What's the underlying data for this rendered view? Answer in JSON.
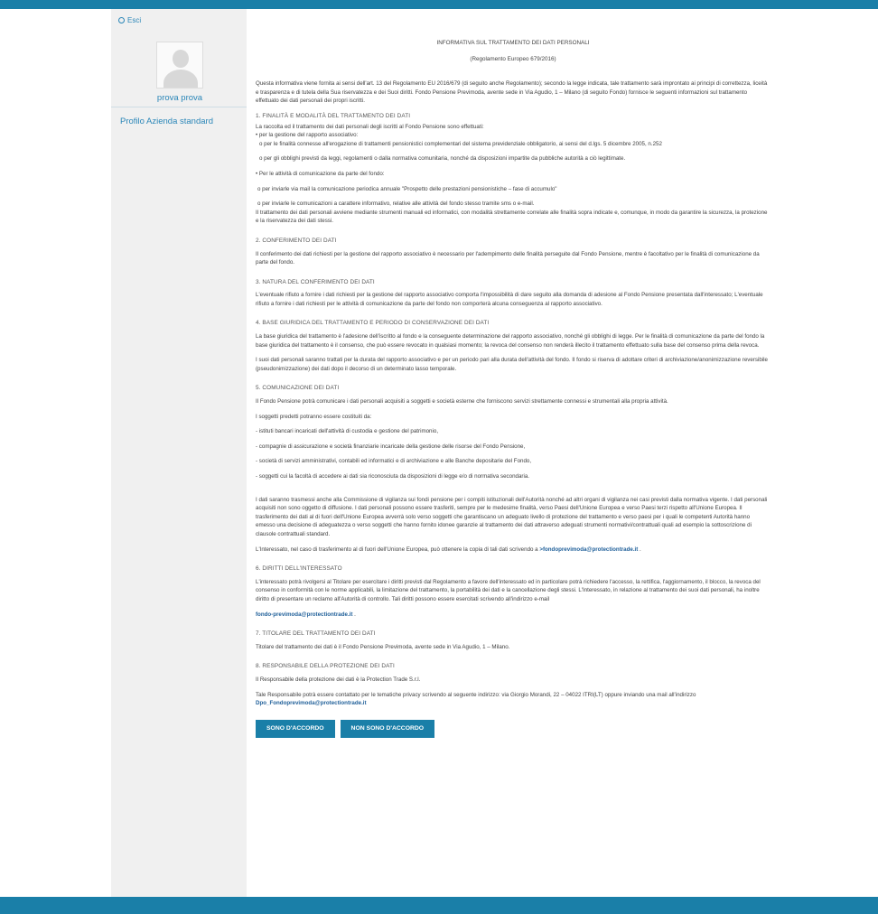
{
  "sidebar": {
    "logout_label": "Esci",
    "user_name": "prova prova",
    "profile_link": "Profilo Azienda standard"
  },
  "document": {
    "title": "INFORMATIVA SUL TRATTAMENTO DEI DATI PERSONALI",
    "subtitle": "(Regolamento Europeo 679/2016)",
    "intro": "Questa informativa viene fornita ai sensi dell'art. 13 del Regolamento EU 2016/679 (di seguito anche Regolamento); secondo la legge indicata, tale trattamento sarà improntato ai principi di correttezza, liceità e trasparenza e di tutela della Sua riservatezza e dei Suoi diritti. Fondo Pensione Previmoda, avente sede in Via Agudio, 1 – Milano (di seguito Fondo) fornisce le seguenti informazioni sul trattamento effettuato dei dati personali dei propri iscritti.",
    "s1": {
      "title": "1. FINALITÀ E MODALITÀ DEL TRATTAMENTO DEI DATI",
      "l1": "La raccolta ed il trattamento dei dati personali degli iscritti al Fondo Pensione sono effettuati:",
      "l2": "• per la gestione del rapporto associativo:",
      "l3": "o per le finalità connesse all'erogazione di trattamenti pensionistici complementari del sistema previdenziale obbligatorio, ai sensi del d.lgs. 5 dicembre 2005, n.252",
      "l4": "o per gli obblighi previsti da leggi, regolamenti o dalla normativa comunitaria, nonché da disposizioni impartite da pubbliche autorità a ciò legittimate.",
      "l5": "• Per le attività di comunicazione da parte del fondo:",
      "l6": "o per inviarle via mail la comunicazione periodica annuale \"Prospetto delle prestazioni pensionistiche – fase di accumulo\"",
      "l7": "o per inviarle le comunicazioni a carattere informativo, relative alle attività del fondo stesso tramite sms o e-mail.",
      "l8": "Il trattamento dei dati personali avviene mediante strumenti manuali ed informatici, con modalità strettamente correlate alle finalità sopra indicate e, comunque, in modo da garantire la sicurezza, la protezione e la riservatezza dei dati stessi."
    },
    "s2": {
      "title": "2. CONFERIMENTO DEI DATI",
      "text": "Il conferimento dei dati richiesti per la gestione del rapporto associativo è necessario per l'adempimento delle finalità perseguite dal Fondo Pensione, mentre è facoltativo per le finalità di comunicazione da parte del fondo."
    },
    "s3": {
      "title": "3. NATURA DEL CONFERIMENTO DEI DATI",
      "text": "L'eventuale rifiuto a fornire i dati richiesti per la gestione del rapporto associativo comporta l'impossibilità di dare seguito alla domanda di adesione al Fondo Pensione presentata dall'interessato; L'eventuale rifiuto a fornire i dati richiesti per le attività di comunicazione da parte del fondo non comporterà alcuna conseguenza al rapporto associativo."
    },
    "s4": {
      "title": "4. BASE GIURIDICA DEL TRATTAMENTO E PERIODO DI CONSERVAZIONE DEI DATI",
      "p1": "La base giuridica del trattamento è l'adesione dell'iscritto al fondo e la conseguente determinazione del rapporto associativo, nonché gli obblighi di legge. Per le finalità di comunicazione da parte del fondo la base giuridica del trattamento è il consenso, che può essere revocato in qualsiasi momento; la revoca del consenso non renderà illecito il trattamento effettuato sulla base del consenso prima della revoca.",
      "p2": "I suoi dati personali saranno trattati per la durata del rapporto associativo e per un periodo pari alla durata dell'attività del fondo. Il fondo si riserva di adottare criteri di archiviazione/anonimizzazione reversibile (pseudonimizzazione) dei dati dopo il decorso di un determinato lasso temporale."
    },
    "s5": {
      "title": "5. COMUNICAZIONE DEI DATI",
      "p1": "Il Fondo Pensione potrà comunicare i dati personali acquisiti a soggetti e società esterne che forniscono servizi strettamente connessi e strumentali alla propria attività.",
      "p2": "I soggetti predetti potranno essere costituiti da:",
      "b1": "- istituti bancari incaricati dell'attività di custodia e gestione del patrimonio,",
      "b2": "- compagnie di assicurazione e società finanziarie incaricate della gestione delle risorse del Fondo Pensione,",
      "b3": "- società di servizi amministrativi, contabili ed informatici e di archiviazione e alle Banche depositarie del Fondo,",
      "b4": "- soggetti cui la facoltà di accedere ai dati sia riconosciuta da disposizioni di legge e/o di normativa secondaria.",
      "p3": "I dati saranno trasmessi anche alla Commissione di vigilanza sui fondi pensione per i compiti istituzionali dell'Autorità nonché ad altri organi di vigilanza nei casi previsti dalla normativa vigente. I dati personali acquisiti non sono oggetto di diffusione. I dati personali possono essere trasferiti, sempre per le medesime finalità, verso Paesi dell'Unione Europea e verso Paesi terzi rispetto all'Unione Europea. Il trasferimento dei dati al di fuori dell'Unione Europea avverrà solo verso soggetti che garantiscano un adeguato livello di protezione del trattamento e verso paesi per i quali le competenti Autorità hanno emesso una decisione di adeguatezza o verso soggetti che hanno fornito idonee garanzie al trattamento dei dati attraverso adeguati strumenti normativi/contrattuali quali ad esempio la sottoscrizione di clausole contrattuali standard.",
      "p4_text": "L'Interessato, nel caso di trasferimento al di fuori dell'Unione Europea, può ottenere la copia di tali dati scrivendo a ",
      "p4_link": ">fondoprevimoda@protectiontrade.it",
      "p4_end": " ."
    },
    "s6": {
      "title": "6. DIRITTI DELL'INTERESSATO",
      "p1": "L'interessato potrà rivolgersi al Titolare per esercitare i diritti previsti dal Regolamento a favore dell'interessato ed in particolare potrà richiedere l'accesso, la rettifica, l'aggiornamento, il blocco, la revoca del consenso in conformità con le norme applicabili, la limitazione del trattamento, la portabilità dei dati e la cancellazione degli stessi. L'Interessato, in relazione al trattamento dei suoi dati personali, ha inoltre diritto di presentare un reclamo all'Autorità di controllo. Tali diritti possono essere esercitati scrivendo all'indirizzo e-mail",
      "link": "fondo-previmoda@protectiontrade.it",
      "link_end": " ."
    },
    "s7": {
      "title": "7. TITOLARE DEL TRATTAMENTO DEI DATI",
      "text": "Titolare del trattamento dei dati è il Fondo Pensione Previmoda, avente sede in Via Agudio, 1 – Milano."
    },
    "s8": {
      "title": "8. RESPONSABILE DELLA PROTEZIONE DEI DATI",
      "p1": "Il Responsabile della protezione dei dati è la Protection Trade S.r.l.",
      "p2_text": "Tale Responsabile potrà essere contattato per le tematiche privacy scrivendo al seguente indirizzo: via Giorgio Morandi, 22 – 04022 ITRI(LT) oppure inviando una mail all'indirizzo ",
      "p2_link": "Dpo_Fondoprevimoda@protectiontrade.it"
    }
  },
  "buttons": {
    "agree": "SONO D'ACCORDO",
    "disagree": "NON SONO D'ACCORDO"
  },
  "colors": {
    "brand": "#1a7fa8",
    "link": "#2a86b8",
    "sidebar_bg": "#f0f0f0"
  }
}
